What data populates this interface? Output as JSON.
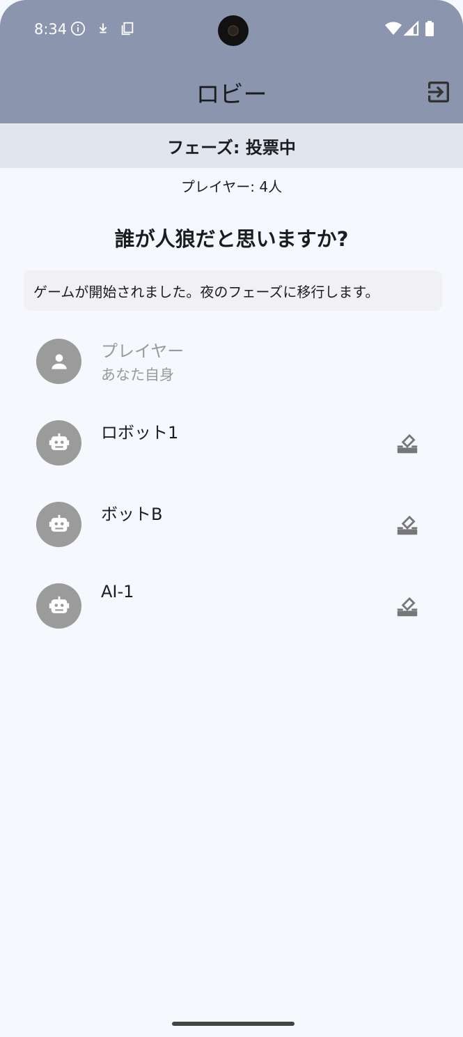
{
  "status_bar": {
    "time": "8:34"
  },
  "app_bar": {
    "title": "ロビー"
  },
  "phase": {
    "label": "フェーズ: 投票中"
  },
  "players_count": "プレイヤー: 4人",
  "question": "誰が人狼だと思いますか?",
  "message": "ゲームが開始されました。夜のフェーズに移行します。",
  "players": [
    {
      "name": "プレイヤー",
      "subtitle": "あなた自身",
      "type": "human"
    },
    {
      "name": "ロボット1",
      "type": "bot"
    },
    {
      "name": "ボットB",
      "type": "bot"
    },
    {
      "name": "AI-1",
      "type": "bot"
    }
  ],
  "icons": {
    "exit": "exit-to-app-icon",
    "vote": "vote-icon",
    "human_avatar": "person-icon",
    "bot_avatar": "robot-icon"
  },
  "colors": {
    "app_bar": "#8b95ad",
    "phase_bar": "#e1e5ee",
    "background": "#f5f8fc",
    "avatar": "#9b9b9b"
  }
}
